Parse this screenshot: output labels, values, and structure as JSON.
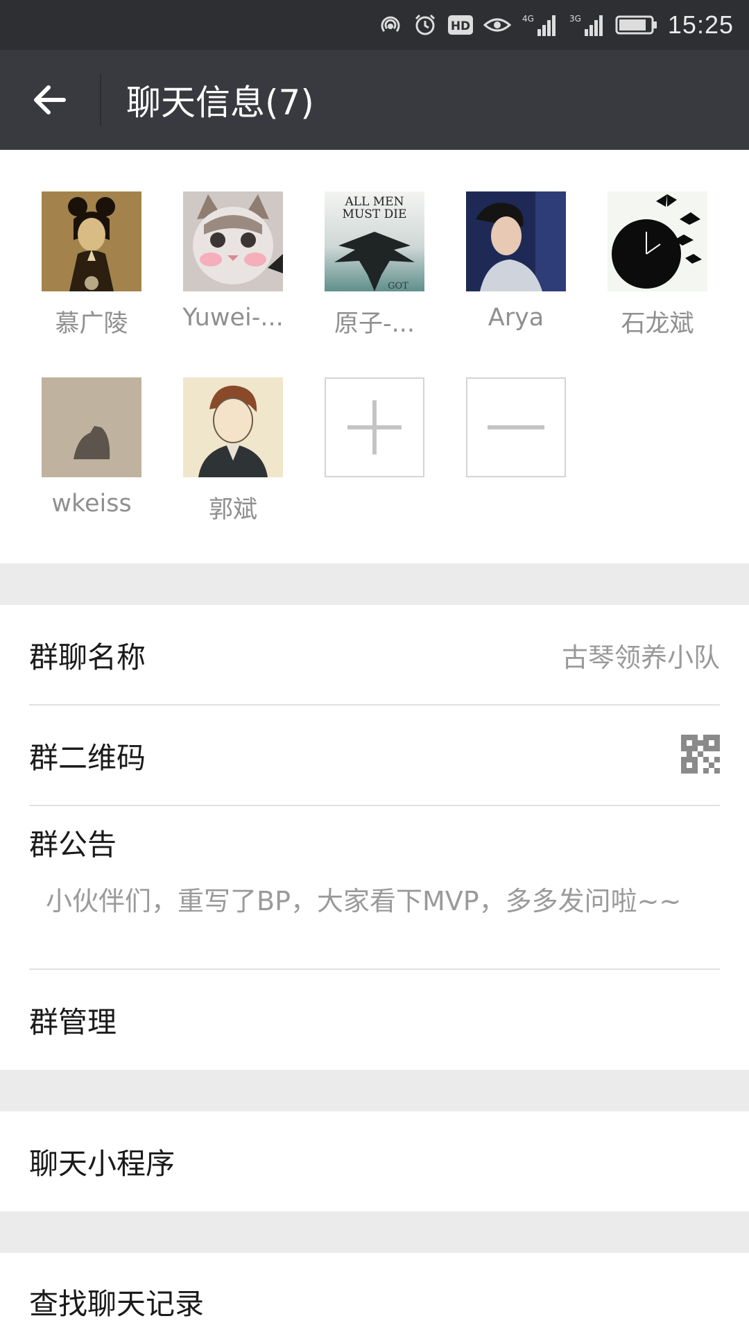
{
  "status_bar": {
    "time": "15:25",
    "net_4g": "4G",
    "net_3g": "3G",
    "hd": "HD"
  },
  "nav": {
    "title": "聊天信息(7)"
  },
  "members": [
    {
      "name": "慕广陵"
    },
    {
      "name": "Yuwei-..."
    },
    {
      "name": "原子-..."
    },
    {
      "name": "Arya"
    },
    {
      "name": "石龙斌"
    },
    {
      "name": "wkeiss"
    },
    {
      "name": "郭斌"
    }
  ],
  "avatar_art": {
    "poster_line1": "ALL MEN",
    "poster_line2": "MUST DIE",
    "poster_tag": "GOT"
  },
  "settings": {
    "group_name_label": "群聊名称",
    "group_name_value": "古琴领养小队",
    "qr_label": "群二维码",
    "notice_label": "群公告",
    "notice_text": "小伙伴们，重写了BP，大家看下MVP，多多发问啦~~",
    "manage_label": "群管理",
    "mini_program_label": "聊天小程序",
    "search_history_label": "查找聊天记录"
  },
  "colors": {
    "status_bar_bg": "#2e2f33",
    "nav_bg": "#393a3f",
    "section_gap": "#ebebeb",
    "secondary_text": "#999999"
  }
}
